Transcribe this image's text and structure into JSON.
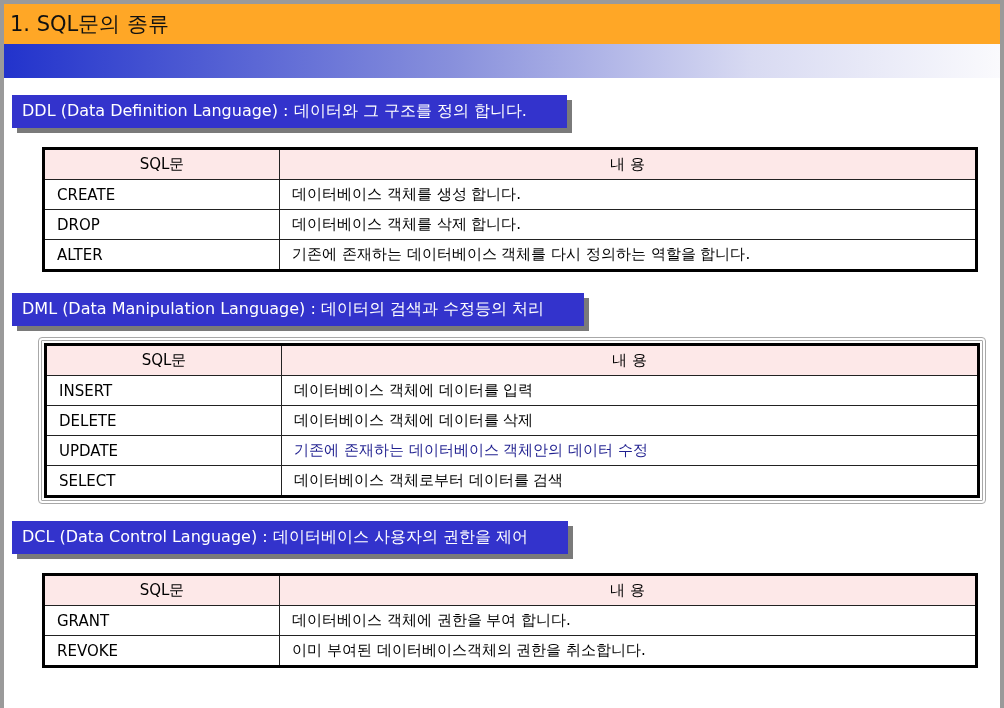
{
  "title": "1. SQL문의 종류",
  "sections": [
    {
      "heading": "DDL (Data Definition Language) : 데이터와 그 구조를 정의 합니다.",
      "selected": false,
      "columns": [
        "SQL문",
        "내 용"
      ],
      "rows": [
        {
          "statement": "CREATE",
          "description": "데이터베이스 객체를 생성 합니다.",
          "color": "#000000"
        },
        {
          "statement": "DROP",
          "description": "데이터베이스 객체를 삭제 합니다.",
          "color": "#000000"
        },
        {
          "statement": "ALTER",
          "description": "기존에 존재하는 데이터베이스 객체를 다시 정의하는 역할을 합니다.",
          "color": "#000000"
        }
      ]
    },
    {
      "heading": "DML (Data Manipulation Language) : 데이터의 검색과 수정등의 처리",
      "selected": true,
      "columns": [
        "SQL문",
        "내 용"
      ],
      "rows": [
        {
          "statement": "INSERT",
          "description": "데이터베이스 객체에 데이터를 입력",
          "color": "#000000"
        },
        {
          "statement": "DELETE",
          "description": "데이터베이스 객체에 데이터를 삭제",
          "color": "#000000"
        },
        {
          "statement": "UPDATE",
          "description": "기존에 존재하는 데이터베이스 객체안의 데이터 수정",
          "color": "#1f1f8f"
        },
        {
          "statement": "SELECT",
          "description": "데이터베이스 객체로부터 데이터를 검색",
          "color": "#000000"
        }
      ]
    },
    {
      "heading": "DCL (Data Control Language) : 데이터베이스 사용자의 권한을 제어",
      "selected": false,
      "columns": [
        "SQL문",
        "내 용"
      ],
      "rows": [
        {
          "statement": "GRANT",
          "description": "데이터베이스 객체에 권한을 부여 합니다.",
          "color": "#000000"
        },
        {
          "statement": "REVOKE",
          "description": "이미 부여된 데이터베이스객체의 권한을 취소합니다.",
          "color": "#000000"
        }
      ]
    }
  ]
}
